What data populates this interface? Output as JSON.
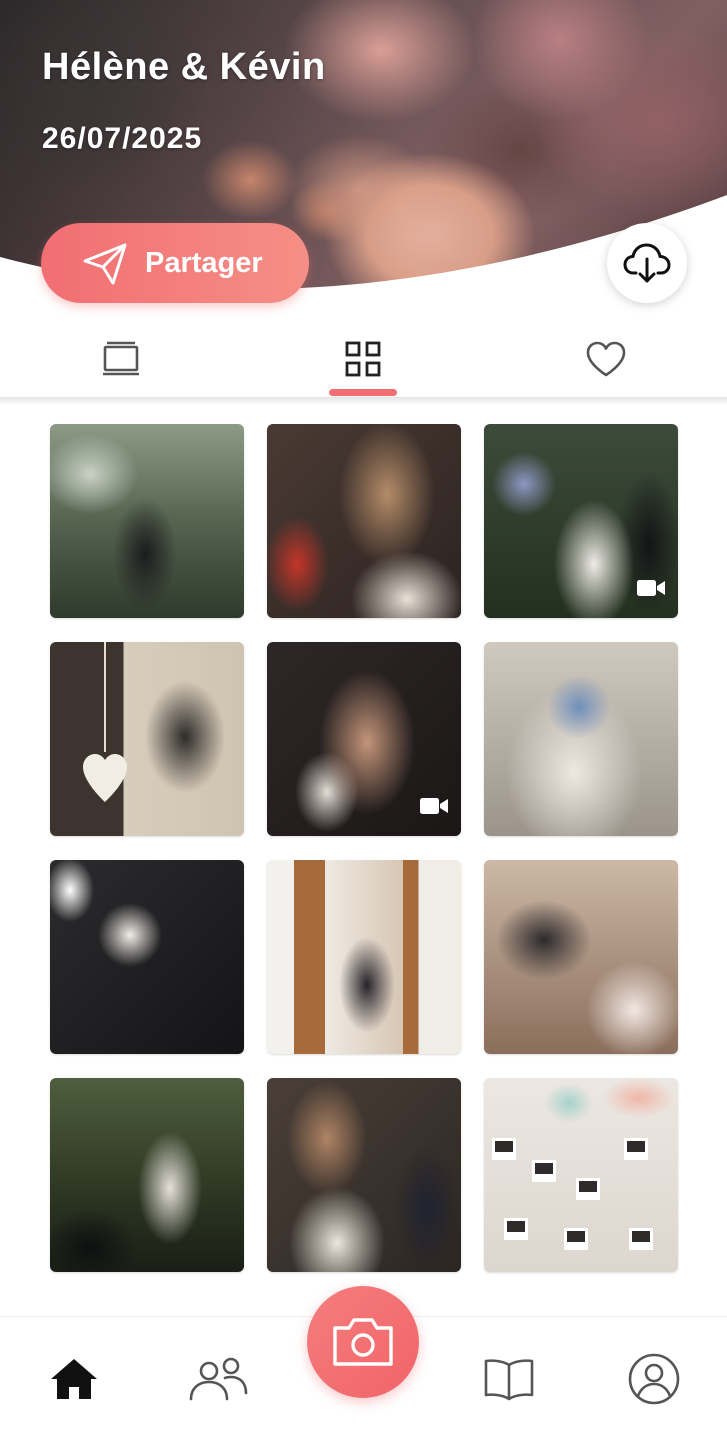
{
  "cover": {
    "title": "Hélène & Kévin",
    "date": "26/07/2025"
  },
  "actions": {
    "share_label": "Partager",
    "download_icon": "cloud-download-icon",
    "share_icon": "paper-plane-icon"
  },
  "tabs": [
    {
      "name": "slideshow",
      "icon": "slideshow-icon",
      "active": false
    },
    {
      "name": "grid",
      "icon": "grid-icon",
      "active": true
    },
    {
      "name": "favorites",
      "icon": "heart-icon",
      "active": false
    }
  ],
  "gallery": {
    "items": [
      {
        "id": 1,
        "type": "photo"
      },
      {
        "id": 2,
        "type": "photo"
      },
      {
        "id": 3,
        "type": "video"
      },
      {
        "id": 4,
        "type": "photo"
      },
      {
        "id": 5,
        "type": "video"
      },
      {
        "id": 6,
        "type": "photo"
      },
      {
        "id": 7,
        "type": "photo"
      },
      {
        "id": 8,
        "type": "photo"
      },
      {
        "id": 9,
        "type": "photo"
      },
      {
        "id": 10,
        "type": "photo"
      },
      {
        "id": 11,
        "type": "photo"
      },
      {
        "id": 12,
        "type": "photo"
      }
    ]
  },
  "bottom_nav": [
    {
      "name": "home",
      "icon": "home-icon",
      "active": true
    },
    {
      "name": "guests",
      "icon": "users-icon",
      "active": false
    },
    {
      "name": "camera",
      "icon": "camera-icon",
      "active": false
    },
    {
      "name": "guestbook",
      "icon": "book-icon",
      "active": false
    },
    {
      "name": "profile",
      "icon": "profile-icon",
      "active": false
    }
  ],
  "colors": {
    "accent": "#f26e72",
    "icon": "#555555",
    "active_icon": "#111111"
  }
}
